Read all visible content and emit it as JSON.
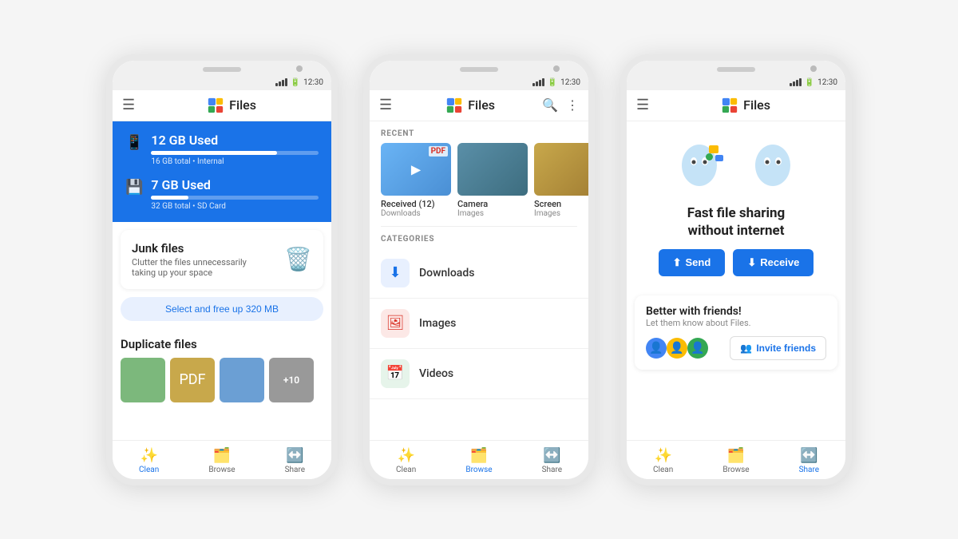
{
  "app": {
    "name": "Files",
    "time": "12:30"
  },
  "phone1": {
    "storage": [
      {
        "label": "12 GB Used",
        "detail": "16 GB total • Internal",
        "fill_pct": 75,
        "icon": "📱"
      },
      {
        "label": "7 GB Used",
        "detail": "32 GB total • SD Card",
        "fill_pct": 22,
        "icon": "💾"
      }
    ],
    "junk": {
      "title": "Junk files",
      "desc": "Clutter the files unnecessarily\ntaking up your space",
      "emoji": "🗑️"
    },
    "select_btn": "Select and free up 320 MB",
    "duplicate": {
      "title": "Duplicate files"
    },
    "nav": [
      {
        "label": "Clean",
        "icon": "✨",
        "active": true
      },
      {
        "label": "Browse",
        "icon": "◻",
        "active": false
      },
      {
        "label": "Share",
        "icon": "↔",
        "active": false
      }
    ]
  },
  "phone2": {
    "sections": {
      "recent_label": "RECENT",
      "categories_label": "CATEGORIES"
    },
    "recent": [
      {
        "name": "Received (12)",
        "sub": "Downloads",
        "thumb_class": "thumb-received",
        "overlay": "▶"
      },
      {
        "name": "Camera",
        "sub": "Images",
        "thumb_class": "thumb-camera",
        "overlay": ""
      },
      {
        "name": "Screen",
        "sub": "Images",
        "thumb_class": "thumb-screen",
        "overlay": ""
      }
    ],
    "categories": [
      {
        "name": "Downloads",
        "icon": "⬇️",
        "color": "#e8f0fe",
        "icon_color": "#1a73e8"
      },
      {
        "name": "Images",
        "icon": "🖼️",
        "color": "#fce8e6",
        "icon_color": "#d93025"
      },
      {
        "name": "Videos",
        "icon": "📅",
        "color": "#e6f4ea",
        "icon_color": "#188038"
      }
    ],
    "nav": [
      {
        "label": "Clean",
        "icon": "✨",
        "active": false
      },
      {
        "label": "Browse",
        "icon": "◻",
        "active": true
      },
      {
        "label": "Share",
        "icon": "↔",
        "active": false
      }
    ]
  },
  "phone3": {
    "hero": {
      "title": "Fast file sharing\nwithout internet",
      "send_label": "Send",
      "receive_label": "Receive"
    },
    "friends": {
      "title": "Better with friends!",
      "desc": "Let them know about Files.",
      "invite_label": "Invite friends"
    },
    "nav": [
      {
        "label": "Clean",
        "icon": "✨",
        "active": false
      },
      {
        "label": "Browse",
        "icon": "◻",
        "active": false
      },
      {
        "label": "Share",
        "icon": "↔",
        "active": true
      }
    ]
  }
}
